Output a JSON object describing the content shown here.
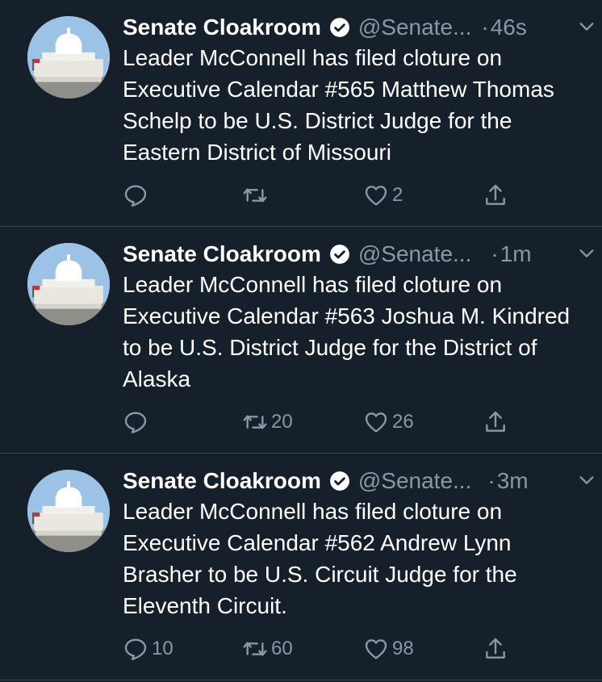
{
  "tweets": [
    {
      "author_name": "Senate Cloakroom",
      "handle": "@Senate...",
      "separator": "·",
      "time": "46s",
      "text": "Leader McConnell has filed cloture on Executive Calendar #565 Matthew Thomas Schelp to be U.S. District Judge for the Eastern District of Missouri",
      "reply_count": "",
      "retweet_count": "",
      "like_count": "2"
    },
    {
      "author_name": "Senate Cloakroom",
      "handle": "@Senate...",
      "separator": "·",
      "time": "1m",
      "text": "Leader McConnell has filed cloture on Executive Calendar #563 Joshua M. Kindred to be U.S. District Judge for the District of Alaska",
      "reply_count": "",
      "retweet_count": "20",
      "like_count": "26"
    },
    {
      "author_name": "Senate Cloakroom",
      "handle": "@Senate...",
      "separator": "·",
      "time": "3m",
      "text": "Leader McConnell has filed cloture on Executive Calendar #562 Andrew Lynn Brasher to be U.S. Circuit Judge for the Eleventh Circuit.",
      "reply_count": "10",
      "retweet_count": "60",
      "like_count": "98"
    }
  ],
  "icons": {
    "avatar": "capitol-building-avatar",
    "verified": "verified-badge-icon",
    "caret": "chevron-down-icon",
    "reply": "reply-icon",
    "retweet": "retweet-icon",
    "like": "heart-icon",
    "share": "share-icon"
  },
  "colors": {
    "background": "#15202b",
    "secondary_text": "#8899a6",
    "divider": "#38444d",
    "primary_text": "#ffffff"
  }
}
